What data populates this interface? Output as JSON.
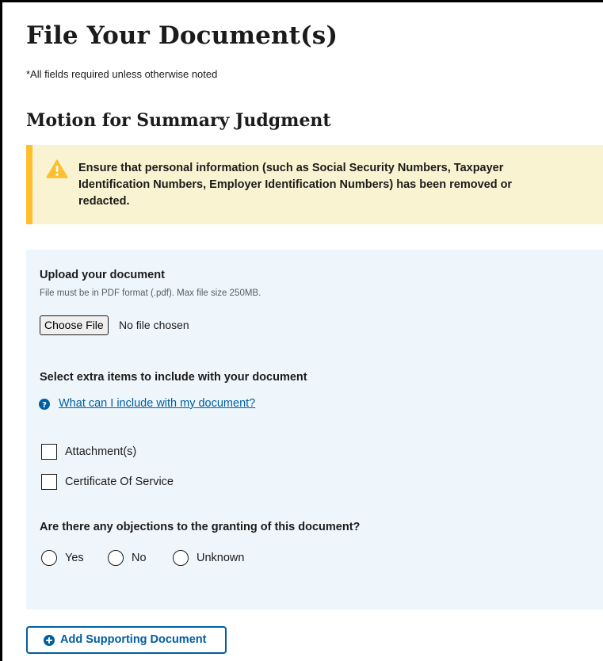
{
  "page": {
    "title": "File Your Document(s)",
    "required_note": "*All fields required unless otherwise noted"
  },
  "section": {
    "title": "Motion for Summary Judgment"
  },
  "warning": {
    "icon": "warning-triangle-icon",
    "text": "Ensure that personal information (such as Social Security Numbers, Taxpayer Identification Numbers, Employer Identification Numbers) has been removed or redacted.",
    "accent_color": "#ffbe2e",
    "background_color": "#faf3d1"
  },
  "upload": {
    "label": "Upload your document",
    "hint": "File must be in PDF format (.pdf). Max file size 250MB.",
    "choose_file_label": "Choose File",
    "file_status": "No file chosen"
  },
  "extra_items": {
    "label": "Select extra items to include with your document",
    "help_link": "What can I include with my document?",
    "help_icon": "question-circle-icon",
    "options": [
      {
        "label": "Attachment(s)",
        "checked": false
      },
      {
        "label": "Certificate Of Service",
        "checked": false
      }
    ]
  },
  "objections": {
    "question": "Are there any objections to the granting of this document?",
    "options": [
      {
        "label": "Yes",
        "selected": false
      },
      {
        "label": "No",
        "selected": false
      },
      {
        "label": "Unknown",
        "selected": false
      }
    ]
  },
  "actions": {
    "add_supporting_label": "Add Supporting Document",
    "add_icon": "plus-circle-icon"
  },
  "colors": {
    "primary": "#005ea2",
    "panel_background": "#eff6fb",
    "text": "#1b1b1b"
  }
}
